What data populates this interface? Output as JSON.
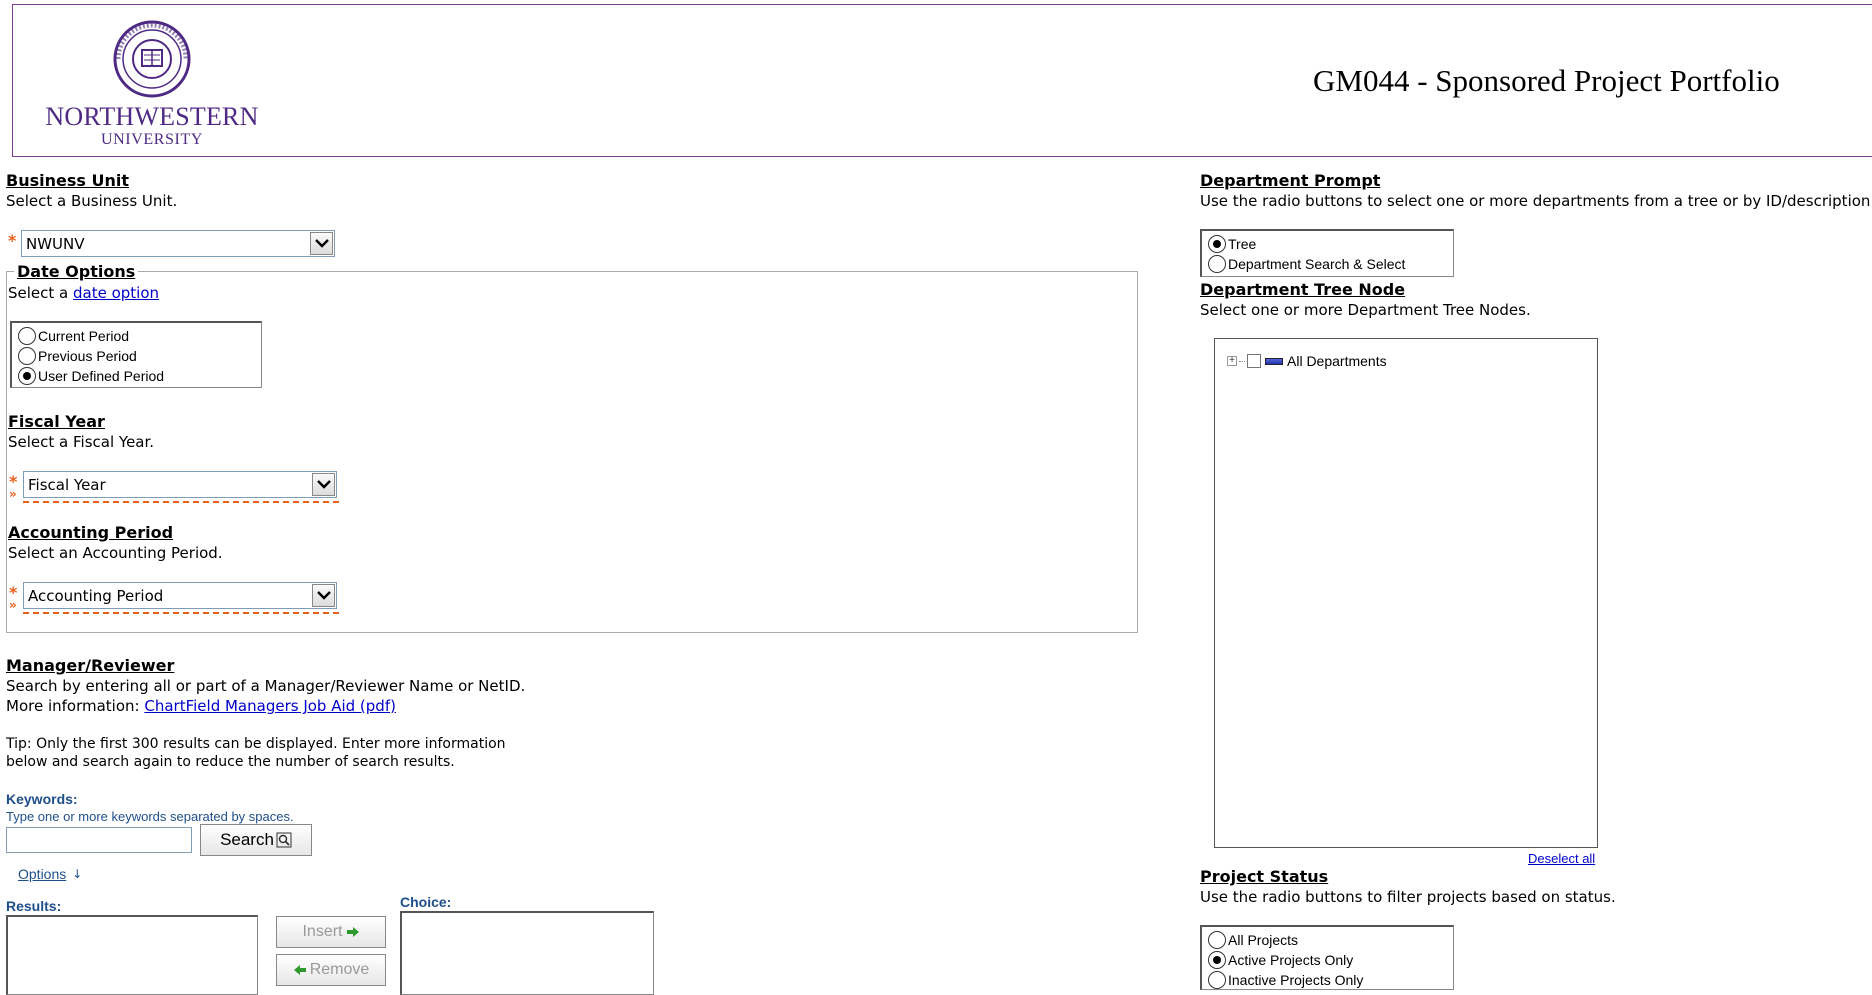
{
  "header": {
    "logo_name": "NORTHWESTERN",
    "logo_sub": "UNIVERSITY",
    "report_title": "GM044 - Sponsored Project Portfolio"
  },
  "business_unit": {
    "title": "Business Unit",
    "desc": "Select a Business Unit.",
    "value": "NWUNV"
  },
  "date_options": {
    "title": "Date Options",
    "desc_prefix": "Select a",
    "desc_link": "date option",
    "options": [
      "Current Period",
      "Previous Period",
      "User Defined Period"
    ],
    "selected": "User Defined Period"
  },
  "fiscal_year": {
    "title": "Fiscal Year",
    "desc": "Select a Fiscal Year.",
    "value": "Fiscal Year"
  },
  "accounting_period": {
    "title": "Accounting Period",
    "desc": "Select an Accounting Period.",
    "value": "Accounting Period"
  },
  "manager": {
    "title": "Manager/Reviewer",
    "desc": "Search by entering all or part of a Manager/Reviewer Name or NetID.",
    "more_info_prefix": "More information:",
    "more_info_link": "ChartField Managers Job Aid (pdf)",
    "tip_line1": "Tip: Only the first 300 results can be displayed. Enter more information",
    "tip_line2": "below and search again to reduce the number of search results.",
    "keywords_label": "Keywords:",
    "keywords_hint": "Type one or more keywords separated by spaces.",
    "keywords_value": "",
    "search_label": "Search",
    "options_label": "Options",
    "results_label": "Results:",
    "choice_label": "Choice:",
    "insert_label": "Insert",
    "remove_label": "Remove"
  },
  "department_prompt": {
    "title": "Department Prompt",
    "desc": "Use the radio buttons to select one or more departments from a tree or by ID/description.",
    "options": [
      "Tree",
      "Department Search & Select"
    ],
    "selected": "Tree"
  },
  "department_tree": {
    "title": "Department Tree Node",
    "desc": "Select one or more Department Tree Nodes.",
    "root_label": "All Departments",
    "deselect_label": "Deselect all"
  },
  "project_status": {
    "title": "Project Status",
    "desc": "Use the radio buttons to filter projects based on status.",
    "options": [
      "All Projects",
      "Active Projects Only",
      "Inactive Projects Only"
    ],
    "selected": "Active Projects Only"
  },
  "colors": {
    "brand_purple": "#4e2a84",
    "required_orange": "#e8601c",
    "link_blue": "#0000cc",
    "prompt_blue": "#1f4f8b"
  }
}
